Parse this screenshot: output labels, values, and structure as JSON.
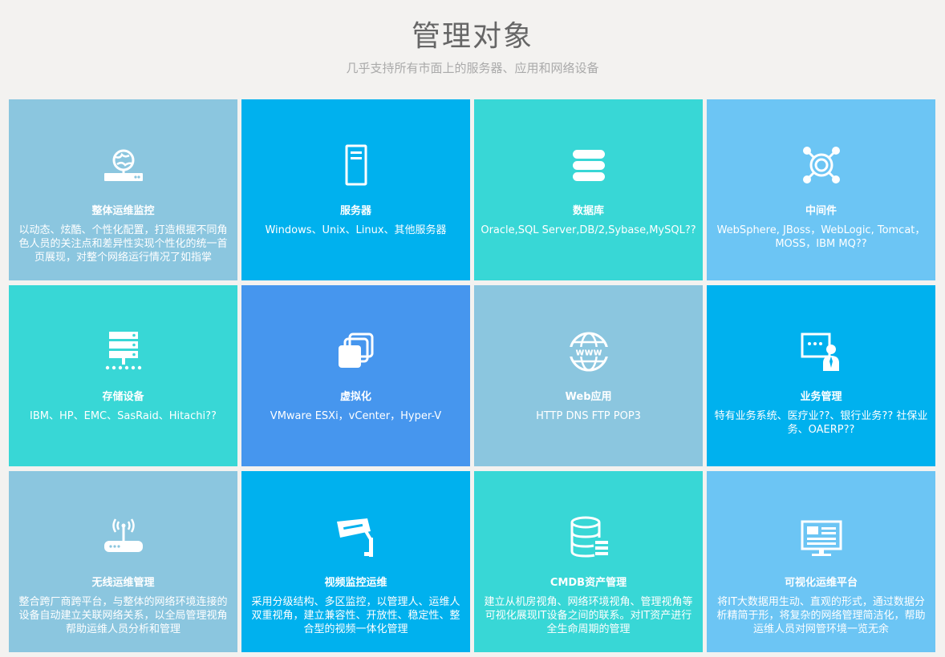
{
  "header": {
    "title": "管理对象",
    "subtitle": "几乎支持所有市面上的服务器、应用和网络设备"
  },
  "colors": {
    "background": "#f3f2f0",
    "steel_blue": "#8bc6df",
    "azure": "#00b1ee",
    "turquoise": "#38d7d6",
    "sky": "#6cc5f4",
    "royal": "#4696ee"
  },
  "cards": [
    {
      "name": "card-overall-monitoring",
      "icon": "globe-router-icon",
      "color": "#8bc6df",
      "title": "整体运维监控",
      "desc": "以动态、炫酷、个性化配置，打造根据不同角色人员的关注点和差异性实现个性化的统一首页展现，对整个网络运行情况了如指掌"
    },
    {
      "name": "card-servers",
      "icon": "server-tower-icon",
      "color": "#00b1ee",
      "title": "服务器",
      "desc": "Windows、Unix、Linux、其他服务器"
    },
    {
      "name": "card-database",
      "icon": "database-icon",
      "color": "#38d7d6",
      "title": "数据库",
      "desc": "Oracle,SQL Server,DB/2,Sybase,MySQL??"
    },
    {
      "name": "card-middleware",
      "icon": "middleware-hub-icon",
      "color": "#6cc5f4",
      "title": "中间件",
      "desc": "WebSphere, JBoss，WebLogic, Tomcat，MOSS，IBM MQ??"
    },
    {
      "name": "card-storage",
      "icon": "storage-rack-icon",
      "color": "#38d7d6",
      "title": "存储设备",
      "desc": "IBM、HP、EMC、SasRaid、Hitachi??"
    },
    {
      "name": "card-virtualization",
      "icon": "layered-squares-icon",
      "color": "#4696ee",
      "title": "虚拟化",
      "desc": "VMware ESXi，vCenter，Hyper-V"
    },
    {
      "name": "card-web-apps",
      "icon": "www-globe-icon",
      "color": "#8bc6df",
      "title": "Web应用",
      "desc": "HTTP DNS FTP POP3"
    },
    {
      "name": "card-business",
      "icon": "presenter-board-icon",
      "color": "#00b1ee",
      "title": "业务管理",
      "desc": "特有业务系统、医疗业??、银行业务?? 社保业务、OAERP??"
    },
    {
      "name": "card-wireless",
      "icon": "wireless-router-icon",
      "color": "#8bc6df",
      "title": "无线运维管理",
      "desc": "整合跨厂商跨平台，与整体的网络环境连接的设备自动建立关联网络关系，以全局管理视角帮助运维人员分析和管理"
    },
    {
      "name": "card-video-surveillance",
      "icon": "cctv-camera-icon",
      "color": "#00b1ee",
      "title": "视频监控运维",
      "desc": "采用分级结构、多区监控，以管理人、运维人双重视角，建立兼容性、开放性、稳定性、整合型的视频一体化管理"
    },
    {
      "name": "card-cmdb",
      "icon": "database-list-icon",
      "color": "#38d7d6",
      "title": "CMDB资产管理",
      "desc": "建立从机房视角、网络环境视角、管理视角等可视化展现IT设备之间的联系。对IT资产进行全生命周期的管理"
    },
    {
      "name": "card-visualization",
      "icon": "monitor-dashboard-icon",
      "color": "#6cc5f4",
      "title": "可视化运维平台",
      "desc": "将IT大数据用生动、直观的形式，通过数据分析精简于形，将复杂的网络管理简洁化，帮助运维人员对网管环境一览无余"
    }
  ]
}
